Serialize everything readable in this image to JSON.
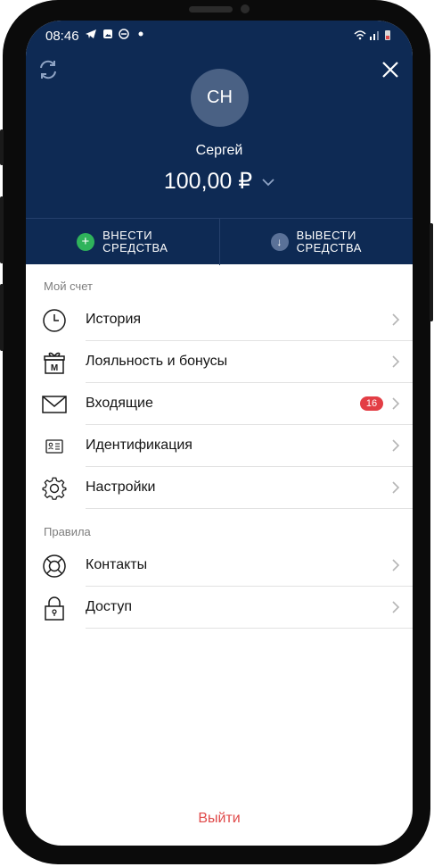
{
  "status": {
    "time": "08:46"
  },
  "header": {
    "avatar_initials": "СН",
    "user_name": "Сергей",
    "balance": "100,00 ₽"
  },
  "actions": {
    "deposit": "ВНЕСТИ\nСРЕДСТВА",
    "withdraw": "ВЫВЕСТИ\nСРЕДСТВА"
  },
  "sections": {
    "account_title": "Мой счет",
    "rules_title": "Правила"
  },
  "menu": {
    "history": "История",
    "loyalty": "Лояльность и бонусы",
    "inbox": "Входящие",
    "inbox_badge": "16",
    "identification": "Идентификация",
    "settings": "Настройки",
    "contacts": "Контакты",
    "access": "Доступ"
  },
  "logout": "Выйти",
  "colors": {
    "header": "#0e2a54",
    "badge": "#e33e45",
    "logout": "#e04a4a",
    "deposit": "#2fb35b"
  }
}
